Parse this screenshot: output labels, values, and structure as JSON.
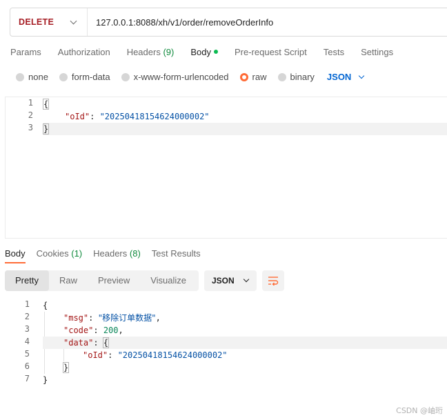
{
  "request": {
    "method": "DELETE",
    "url": "127.0.0.1:8088/xh/v1/order/removeOrderInfo"
  },
  "request_tabs": [
    {
      "label": "Params"
    },
    {
      "label": "Authorization"
    },
    {
      "label": "Headers",
      "count": "(9)"
    },
    {
      "label": "Body"
    },
    {
      "label": "Pre-request Script"
    },
    {
      "label": "Tests"
    },
    {
      "label": "Settings"
    }
  ],
  "body_types": {
    "none": "none",
    "form_data": "form-data",
    "urlencoded": "x-www-form-urlencoded",
    "raw": "raw",
    "binary": "binary",
    "format": "JSON"
  },
  "request_body": {
    "line_numbers": [
      "1",
      "2",
      "3"
    ],
    "open_brace": "{",
    "key": "\"oId\"",
    "colon": ": ",
    "value": "\"20250418154624000002\"",
    "close_brace": "}"
  },
  "response_tabs": {
    "body": "Body",
    "cookies": "Cookies",
    "cookies_count": "(1)",
    "headers": "Headers",
    "headers_count": "(8)",
    "test_results": "Test Results"
  },
  "view_modes": {
    "pretty": "Pretty",
    "raw": "Raw",
    "preview": "Preview",
    "visualize": "Visualize",
    "format": "JSON"
  },
  "response_body": {
    "line_numbers": [
      "1",
      "2",
      "3",
      "4",
      "5",
      "6",
      "7"
    ],
    "open_brace": "{",
    "msg_key": "\"msg\"",
    "msg_value": "\"移除订单数据\"",
    "code_key": "\"code\"",
    "code_value": "200",
    "data_key": "\"data\"",
    "inner_open": "{",
    "oid_key": "\"oId\"",
    "oid_value": "\"20250418154624000002\"",
    "inner_close": "}",
    "close_brace": "}"
  },
  "watermark": "CSDN @岫珩",
  "colors": {
    "method": "#a61d24",
    "accent": "#ff6c37",
    "link": "#0265d2",
    "count": "#0f8a3c"
  }
}
